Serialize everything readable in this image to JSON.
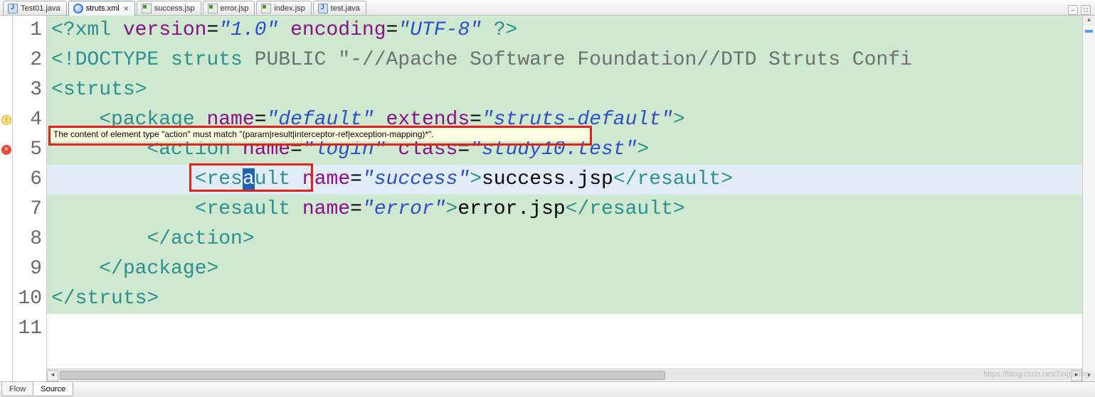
{
  "tabs": [
    {
      "label": "Test01.java",
      "icon": "java",
      "active": false,
      "closeable": false
    },
    {
      "label": "struts.xml",
      "icon": "xml",
      "active": true,
      "closeable": true
    },
    {
      "label": "success.jsp",
      "icon": "jsp",
      "active": false,
      "closeable": false
    },
    {
      "label": "error.jsp",
      "icon": "jsp",
      "active": false,
      "closeable": false
    },
    {
      "label": "index.jsp",
      "icon": "jsp",
      "active": false,
      "closeable": false
    },
    {
      "label": "test.java",
      "icon": "java",
      "active": false,
      "closeable": false
    }
  ],
  "line_numbers": [
    "1",
    "2",
    "3",
    "4",
    "5",
    "6",
    "7",
    "8",
    "9",
    "10",
    "11"
  ],
  "gutter_markers": [
    {
      "line": 4,
      "kind": "warn",
      "glyph": "!"
    },
    {
      "line": 5,
      "kind": "err",
      "glyph": "×"
    }
  ],
  "code": {
    "l1": {
      "a": "<?",
      "b": "xml ",
      "c": "version",
      "d": "=",
      "e": "\"1.0\"",
      "f": " ",
      "g": "encoding",
      "h": "=",
      "i": "\"UTF-8\"",
      "j": " ?>"
    },
    "l2": {
      "a": "<!",
      "b": "DOCTYPE ",
      "c": "struts ",
      "d": "PUBLIC ",
      "e": "\"-//Apache Software Foundation//DTD Struts Confi"
    },
    "l3": {
      "a": "<",
      "b": "struts",
      "c": ">"
    },
    "l4": {
      "ind": "    ",
      "a": "<",
      "b": "package ",
      "c": "name",
      "d": "=",
      "e": "\"default\"",
      "f": " ",
      "g": "extends",
      "h": "=",
      "i": "\"struts-default\"",
      "j": ">"
    },
    "l5": {
      "ind": "        ",
      "a": "<",
      "b": "action ",
      "c": "name",
      "d": "=",
      "e": "\"login\"",
      "f": " ",
      "g": "class",
      "h": "=",
      "i": "\"study10.test\"",
      "j": ">"
    },
    "l6": {
      "ind": "            ",
      "a": "<",
      "b1": "res",
      "b2": "a",
      "b3": "ult",
      "sp": " ",
      "c": "name",
      "d": "=",
      "e": "\"success\"",
      "f": ">",
      "g": "success.jsp",
      "h": "</",
      "i": "resault",
      "j": ">"
    },
    "l7": {
      "ind": "            ",
      "a": "<",
      "b": "resault ",
      "c": "name",
      "d": "=",
      "e": "\"error\"",
      "f": ">",
      "g": "error.jsp",
      "h": "</",
      "i": "resault",
      "j": ">"
    },
    "l8": {
      "ind": "        ",
      "a": "</",
      "b": "action",
      "c": ">"
    },
    "l9": {
      "ind": "    ",
      "a": "</",
      "b": "package",
      "c": ">"
    },
    "l10": {
      "a": "</",
      "b": "struts",
      "c": ">"
    },
    "l11": {
      "a": ""
    }
  },
  "tooltip": "The content of element type \"action\" must match \"(param|result|interceptor-ref|exception-mapping)*\".",
  "bottom_tabs": [
    {
      "label": "Flow",
      "active": false
    },
    {
      "label": "Source",
      "active": true
    }
  ],
  "watermark": "https://blog.csdn.net/Ting1king"
}
